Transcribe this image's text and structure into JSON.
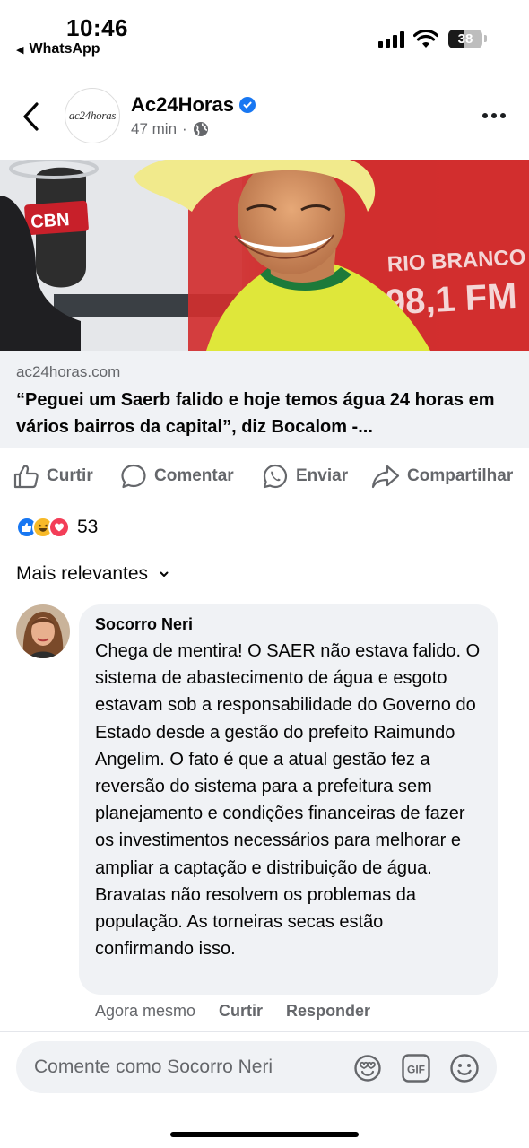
{
  "status_bar": {
    "time": "10:46",
    "back_app": "WhatsApp",
    "battery": "38"
  },
  "post": {
    "page_name": "Ac24Horas",
    "page_logo_text": "ac24horas",
    "time_ago": "47 min",
    "meta_separator": "·",
    "image_labels": {
      "mic_brand": "CBN",
      "station_city": "RIO BRANCO",
      "station_freq": "98,1 FM"
    },
    "link_domain": "ac24horas.com",
    "link_title": "“Peguei um Saerb falido e hoje temos água 24 horas em vários bairros da capital”, diz Bocalom -..."
  },
  "actions": {
    "like": "Curtir",
    "comment": "Comentar",
    "send": "Enviar",
    "share": "Compartilhar"
  },
  "reactions": {
    "count": "53",
    "types": [
      "like",
      "haha",
      "love"
    ],
    "colors": {
      "like": "#1877f2",
      "haha": "#f7b928",
      "love": "#f33e58"
    }
  },
  "sort": {
    "label": "Mais relevantes"
  },
  "comment": {
    "author": "Socorro Neri",
    "text": "Chega de mentira! O SAER não estava falido. O sistema de abastecimento de água e esgoto estavam sob a responsabilidade do Governo do Estado desde a gestão do prefeito Raimundo Angelim. O fato é que a atual gestão fez a reversão do sistema para a prefeitura sem planejamento e condições financeiras de fazer os investimentos necessários para melhorar e ampliar a captação e distribuição de água. Bravatas não resolvem os problemas da população. As torneiras secas estão confirmando isso.",
    "time": "Agora mesmo",
    "like": "Curtir",
    "reply": "Responder"
  },
  "composer": {
    "placeholder": "Comente como Socorro Neri",
    "gif_label": "GIF"
  }
}
